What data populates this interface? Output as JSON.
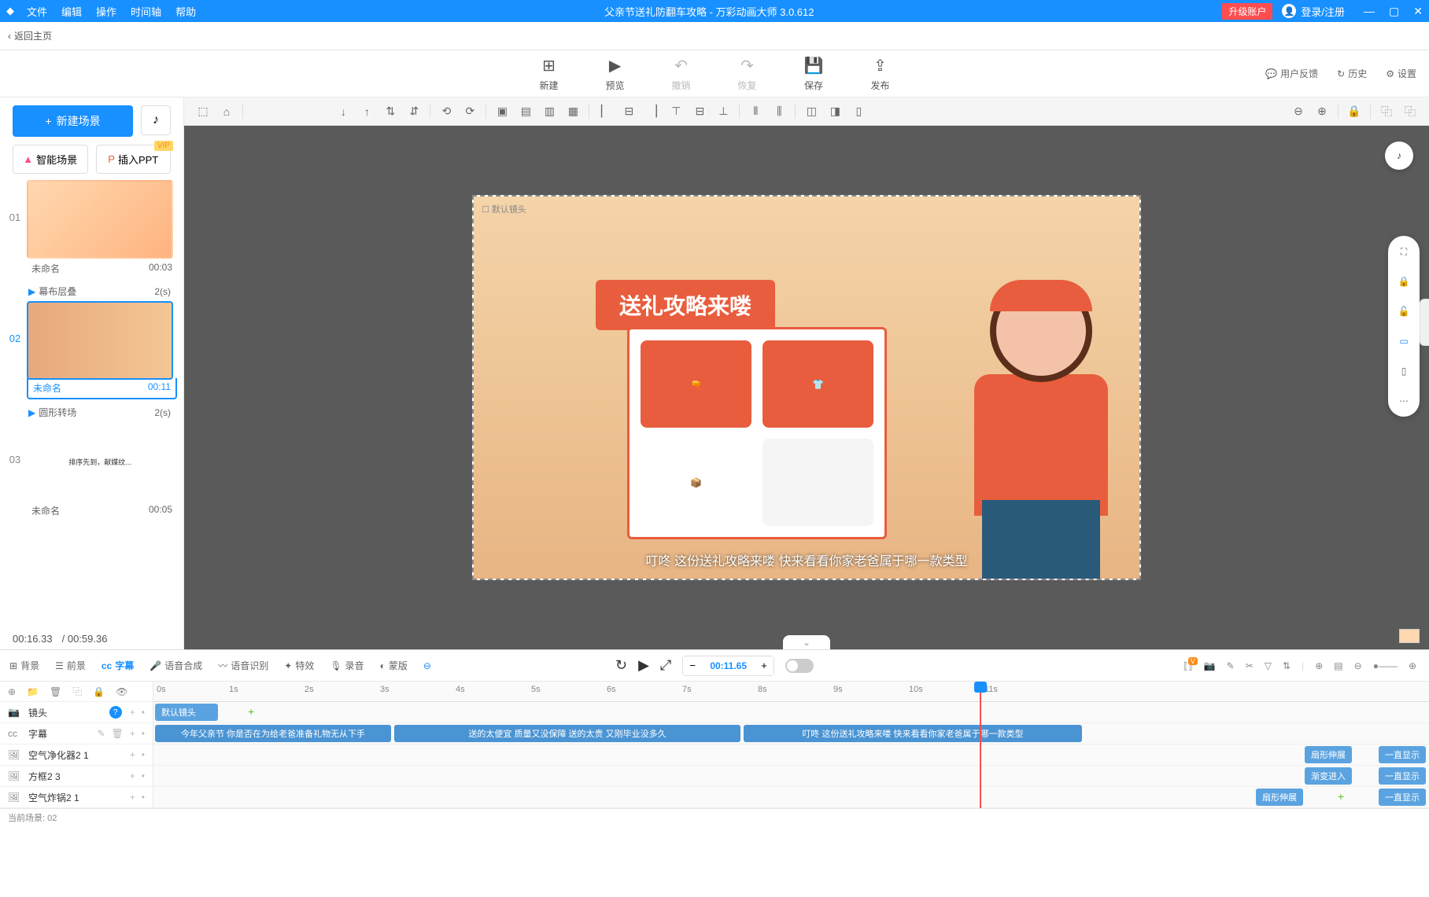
{
  "title_bar": {
    "menus": [
      "文件",
      "编辑",
      "操作",
      "时间轴",
      "帮助"
    ],
    "document_title": "父亲节送礼防翻车攻略 - 万彩动画大师 3.0.612",
    "upgrade": "升级账户",
    "login": "登录/注册"
  },
  "back_bar": {
    "back": "返回主页"
  },
  "toolbar": {
    "new": "新建",
    "preview": "预览",
    "undo": "撤销",
    "redo": "恢复",
    "save": "保存",
    "publish": "发布",
    "feedback": "用户反馈",
    "history": "历史",
    "settings": "设置"
  },
  "sidebar": {
    "new_scene": "新建场景",
    "smart_scene": "智能场景",
    "import_ppt": "插入PPT",
    "vip": "VIP",
    "scenes": [
      {
        "num": "01",
        "name": "未命名",
        "duration": "00:03",
        "transition": "幕布层叠",
        "trans_dur": "2(s)"
      },
      {
        "num": "02",
        "name": "未命名",
        "duration": "00:11",
        "transition": "圆形转场",
        "trans_dur": "2(s)"
      },
      {
        "num": "03",
        "name": "未命名",
        "duration": "00:05"
      }
    ],
    "current_time": "00:16.33",
    "total_time": "/ 00:59.36"
  },
  "canvas": {
    "default_camera": "默认镜头",
    "banner": "送礼攻略来喽",
    "subtitle": "叮咚 这份送礼攻略来喽  快来看看你家老爸属于哪一款类型"
  },
  "timeline": {
    "tabs": [
      "背景",
      "前景",
      "字幕",
      "语音合成",
      "语音识别",
      "特效",
      "录音",
      "蒙版"
    ],
    "current_time": "00:11.65",
    "ruler": [
      "0s",
      "1s",
      "2s",
      "3s",
      "4s",
      "5s",
      "6s",
      "7s",
      "8s",
      "9s",
      "10s",
      "11s"
    ],
    "tracks": {
      "camera": "镜头",
      "subtitle": "字幕",
      "air": "空气净化器2 1",
      "box": "方框2 3",
      "fryer": "空气炸锅2 1"
    },
    "clips": {
      "default_camera": "默认镜头",
      "sub1": "今年父亲节 你是否在为给老爸准备礼物无从下手",
      "sub2": "送的太便宜 质量又没保障 送的太贵 又刚毕业没多久",
      "sub3": "叮咚 这份送礼攻略来喽  快来看看你家老爸属于哪一款类型"
    },
    "effects": {
      "shape_stretch": "扇形伸展",
      "always_show": "一直显示",
      "fade_in": "渐变进入"
    }
  },
  "status": {
    "current_scene": "当前场景: 02"
  }
}
